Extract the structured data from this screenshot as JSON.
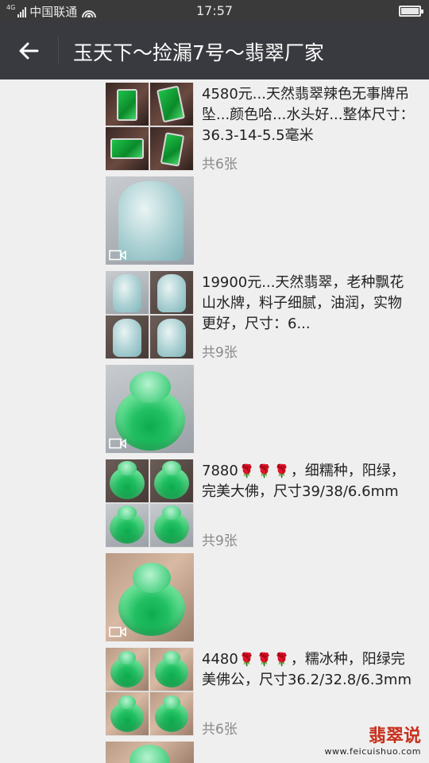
{
  "status_bar": {
    "network": "4G",
    "carrier": "中国联通",
    "time": "17:57"
  },
  "header": {
    "title": "玉天下～捡漏7号～翡翠厂家"
  },
  "posts": [
    {
      "text": "4580元...天然翡翠辣色无事牌吊坠...颜色哈...水头好...整体尺寸：36.3-14-5.5毫米",
      "count": "共6张"
    },
    {
      "text": "19900元...天然翡翠，老种飘花山水牌，料子细腻，油润，实物更好，尺寸：6...",
      "count": "共9张"
    },
    {
      "text_parts": [
        "7880",
        "，细糯种，阳绿，完美大佛，尺寸39/38/6.6mm"
      ],
      "count": "共9张"
    },
    {
      "text_parts": [
        "4480",
        "，糯冰种，阳绿完美佛公，尺寸36.2/32.8/6.3mm"
      ],
      "count": "共6张"
    }
  ],
  "icons": {
    "rose": "rose-emoji",
    "video": "video-icon",
    "back": "back-arrow-icon"
  },
  "watermark": {
    "title": "翡翠说",
    "url": "www.feicuishuo.com"
  },
  "colors": {
    "title_bar": "#393a3f",
    "status_bar": "#3a3a3a",
    "background": "#efefef",
    "count_text": "#8a8a8a",
    "watermark": "#c8301c"
  }
}
